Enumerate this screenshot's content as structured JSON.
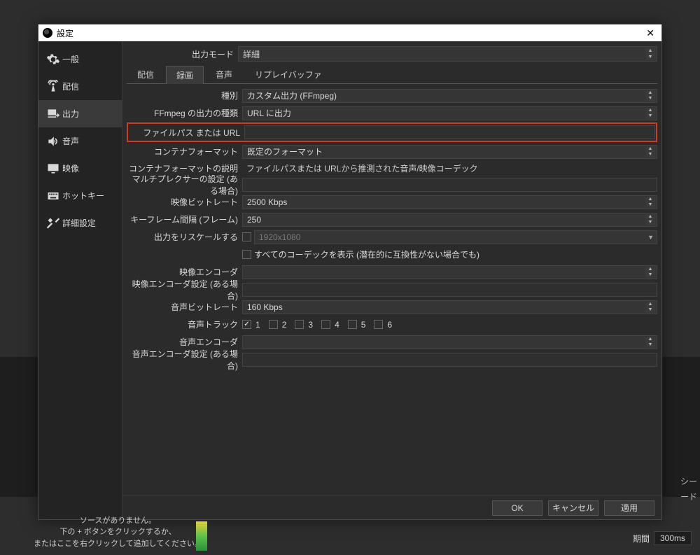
{
  "dialog": {
    "title": "設定"
  },
  "sidebar": {
    "items": [
      {
        "label": "一般"
      },
      {
        "label": "配信"
      },
      {
        "label": "出力"
      },
      {
        "label": "音声"
      },
      {
        "label": "映像"
      },
      {
        "label": "ホットキー"
      },
      {
        "label": "詳細設定"
      }
    ]
  },
  "output_mode": {
    "label": "出力モード",
    "value": "詳細"
  },
  "tabs": [
    "配信",
    "録画",
    "音声",
    "リプレイバッファ"
  ],
  "form": {
    "type": {
      "label": "種別",
      "value": "カスタム出力 (FFmpeg)"
    },
    "ffmpeg_out_type": {
      "label": "FFmpeg の出力の種類",
      "value": "URL に出力"
    },
    "path_or_url": {
      "label": "ファイルパス または URL",
      "value": ""
    },
    "container": {
      "label": "コンテナフォーマット",
      "value": "既定のフォーマット"
    },
    "container_desc": {
      "label": "コンテナフォーマットの説明",
      "value": "ファイルパスまたは URLから推測された音声/映像コーデック"
    },
    "muxer": {
      "label": "マルチプレクサーの設定 (ある場合)",
      "value": ""
    },
    "vbitrate": {
      "label": "映像ビットレート",
      "value": "2500 Kbps"
    },
    "keyframe": {
      "label": "キーフレーム間隔 (フレーム)",
      "value": "250"
    },
    "rescale": {
      "label": "出力をリスケールする",
      "value": "1920x1080"
    },
    "show_all_codecs": {
      "label": "すべてのコーデックを表示 (潜在的に互換性がない場合でも)"
    },
    "venc": {
      "label": "映像エンコーダ",
      "value": ""
    },
    "venc_settings": {
      "label": "映像エンコーダ設定 (ある場合)",
      "value": ""
    },
    "abitrate": {
      "label": "音声ビットレート",
      "value": "160 Kbps"
    },
    "tracks": {
      "label": "音声トラック",
      "values": [
        "1",
        "2",
        "3",
        "4",
        "5",
        "6"
      ]
    },
    "aenc": {
      "label": "音声エンコーダ",
      "value": ""
    },
    "aenc_settings": {
      "label": "音声エンコーダ設定 (ある場合)",
      "value": ""
    }
  },
  "footer": {
    "ok": "OK",
    "cancel": "キャンセル",
    "apply": "適用"
  },
  "background": {
    "no_source_1": "ソースがありません。",
    "no_source_2": "下の + ボタンをクリックするか、",
    "no_source_3": "またはここを右クリックして追加してください。",
    "duration_label": "期間",
    "duration_value": "300ms",
    "cut_1": "シー",
    "cut_2": "ード"
  }
}
